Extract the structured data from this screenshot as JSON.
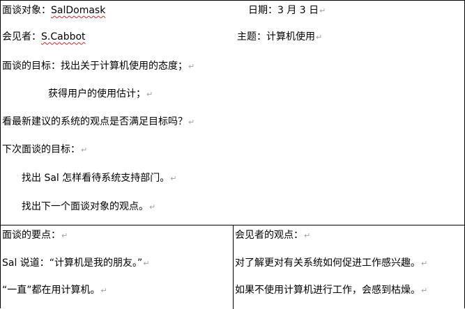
{
  "pilcrow": "↵",
  "header": {
    "interviewee_label": "面谈对象：",
    "interviewee_name": "SalDomask",
    "date_label": "日期：",
    "date_value": "3 月 3 日",
    "interviewer_label": "会见者：",
    "interviewer_name": "S.Cabbot",
    "topic_label": "主题：",
    "topic_value": "计算机使用"
  },
  "goals": {
    "heading": "面谈的目标：",
    "items": [
      "找出关于计算机使用的态度；",
      "获得用户的使用估计；"
    ],
    "question": "看最新建议的系统的观点是否满足目标吗？"
  },
  "next_goals": {
    "heading": "下次面谈的目标：",
    "items": [
      "找出 Sal 怎样看待系统支持部门。",
      "找出下一个面谈对象的观点。"
    ]
  },
  "key_points": {
    "heading": "面谈的要点：",
    "items": [
      "Sal 说道：“计算机是我的朋友。”",
      "“一直”都在用计算机。"
    ]
  },
  "interviewer_views": {
    "heading": "会见者的观点：",
    "items": [
      "对了解更对有关系统如何促进工作感兴趣。",
      "如果不使用计算机进行工作，会感到枯燥。"
    ]
  }
}
